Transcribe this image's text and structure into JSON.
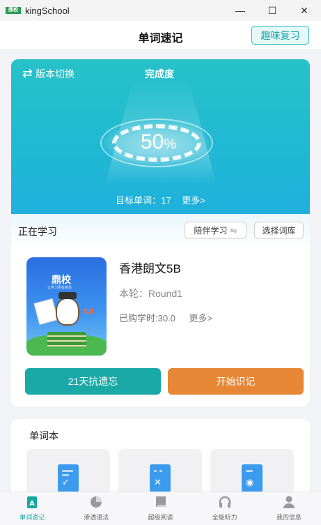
{
  "window": {
    "app_logo_text": "鼎校",
    "title": "kingSchool",
    "minimize_glyph": "—",
    "maximize_glyph": "☐",
    "close_glyph": "✕"
  },
  "header": {
    "title": "单词速记",
    "fun_review_label": "趣味复习"
  },
  "hero": {
    "switch_version_label": "版本切换",
    "completion_label": "完成度",
    "percent_value": "50",
    "percent_sign": "%",
    "target_words_label": "目标单词：17",
    "more_label": "更多>"
  },
  "learning": {
    "section_label": "正在学习",
    "companion_label": "陪伴学习",
    "select_library_label": "选择词库",
    "book": {
      "cover_brand": "鼎校",
      "cover_subtitle": "让学习更有意思",
      "title": "香港朗文5B",
      "round_label": "本轮：Round1",
      "hours_label": "已购学时:30.0",
      "more_label": "更多>"
    },
    "anti_forget_button": "21天抗遗忘",
    "start_button": "开始识记"
  },
  "wordbook": {
    "title": "单词本",
    "cards": [
      {
        "icon": "check-doc-icon",
        "mark": "✓"
      },
      {
        "icon": "wrong-doc-icon",
        "mark": "✕"
      },
      {
        "icon": "record-doc-icon",
        "mark": "◉"
      }
    ]
  },
  "bottom_nav": {
    "items": [
      {
        "label": "单词速记",
        "icon": "word-a-icon",
        "active": true
      },
      {
        "label": "渗透语法",
        "icon": "pie-chart-icon",
        "active": false
      },
      {
        "label": "超级阅读",
        "icon": "book-icon",
        "active": false
      },
      {
        "label": "全能听力",
        "icon": "headphones-icon",
        "active": false
      },
      {
        "label": "我的信息",
        "icon": "user-icon",
        "active": false
      }
    ]
  },
  "colors": {
    "accent": "#1aa9a7",
    "start": "#e78735",
    "hero": "#22bccb"
  }
}
